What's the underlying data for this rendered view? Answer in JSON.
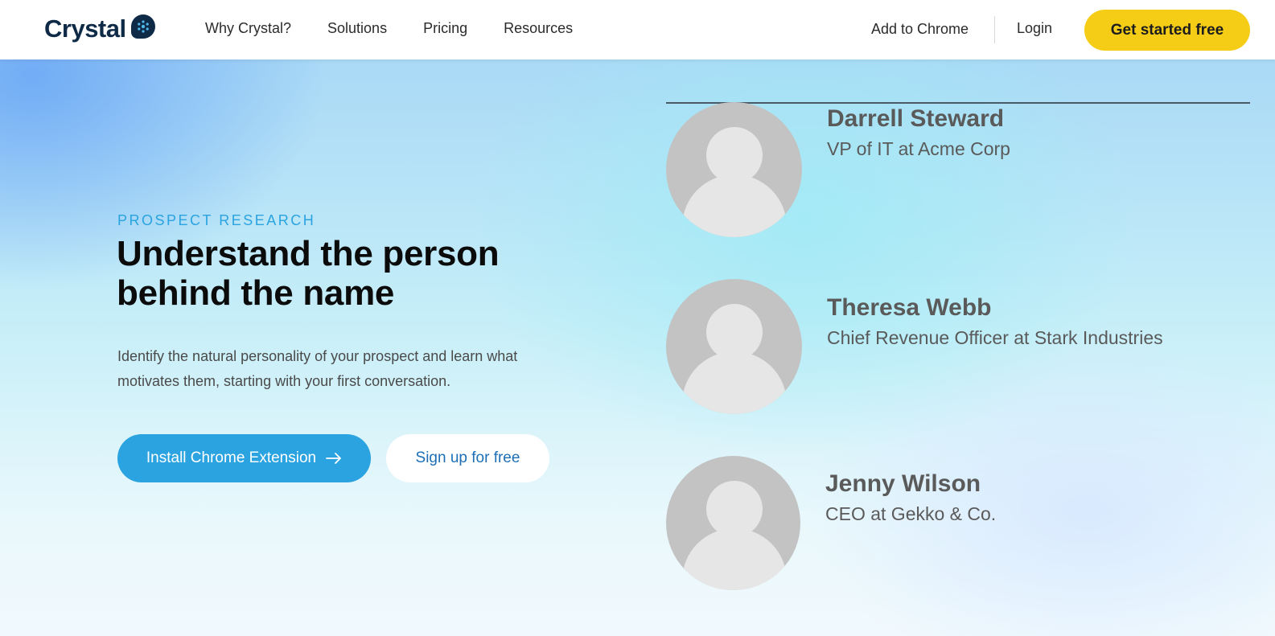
{
  "header": {
    "logo_text": "Crystal",
    "nav": [
      "Why Crystal?",
      "Solutions",
      "Pricing",
      "Resources"
    ],
    "add_to_chrome": "Add to Chrome",
    "login": "Login",
    "cta": "Get started free",
    "cta_color": "#f5cd17"
  },
  "hero": {
    "eyebrow": "PROSPECT RESEARCH",
    "headline_line1": "Understand the person",
    "headline_line2": "behind the name",
    "description_line1": "Identify the natural personality of your prospect and learn what",
    "description_line2": "motivates them, starting with your first conversation.",
    "install_button": "Install Chrome Extension",
    "signup_button": "Sign up for free",
    "accent_color": "#2aa3e0"
  },
  "profiles": [
    {
      "name": "Darrell Steward",
      "role": "VP of IT at Acme Corp"
    },
    {
      "name": "Theresa Webb",
      "role": "Chief Revenue Officer at Stark Industries"
    },
    {
      "name": "Jenny Wilson",
      "role": "CEO at Gekko & Co."
    }
  ]
}
